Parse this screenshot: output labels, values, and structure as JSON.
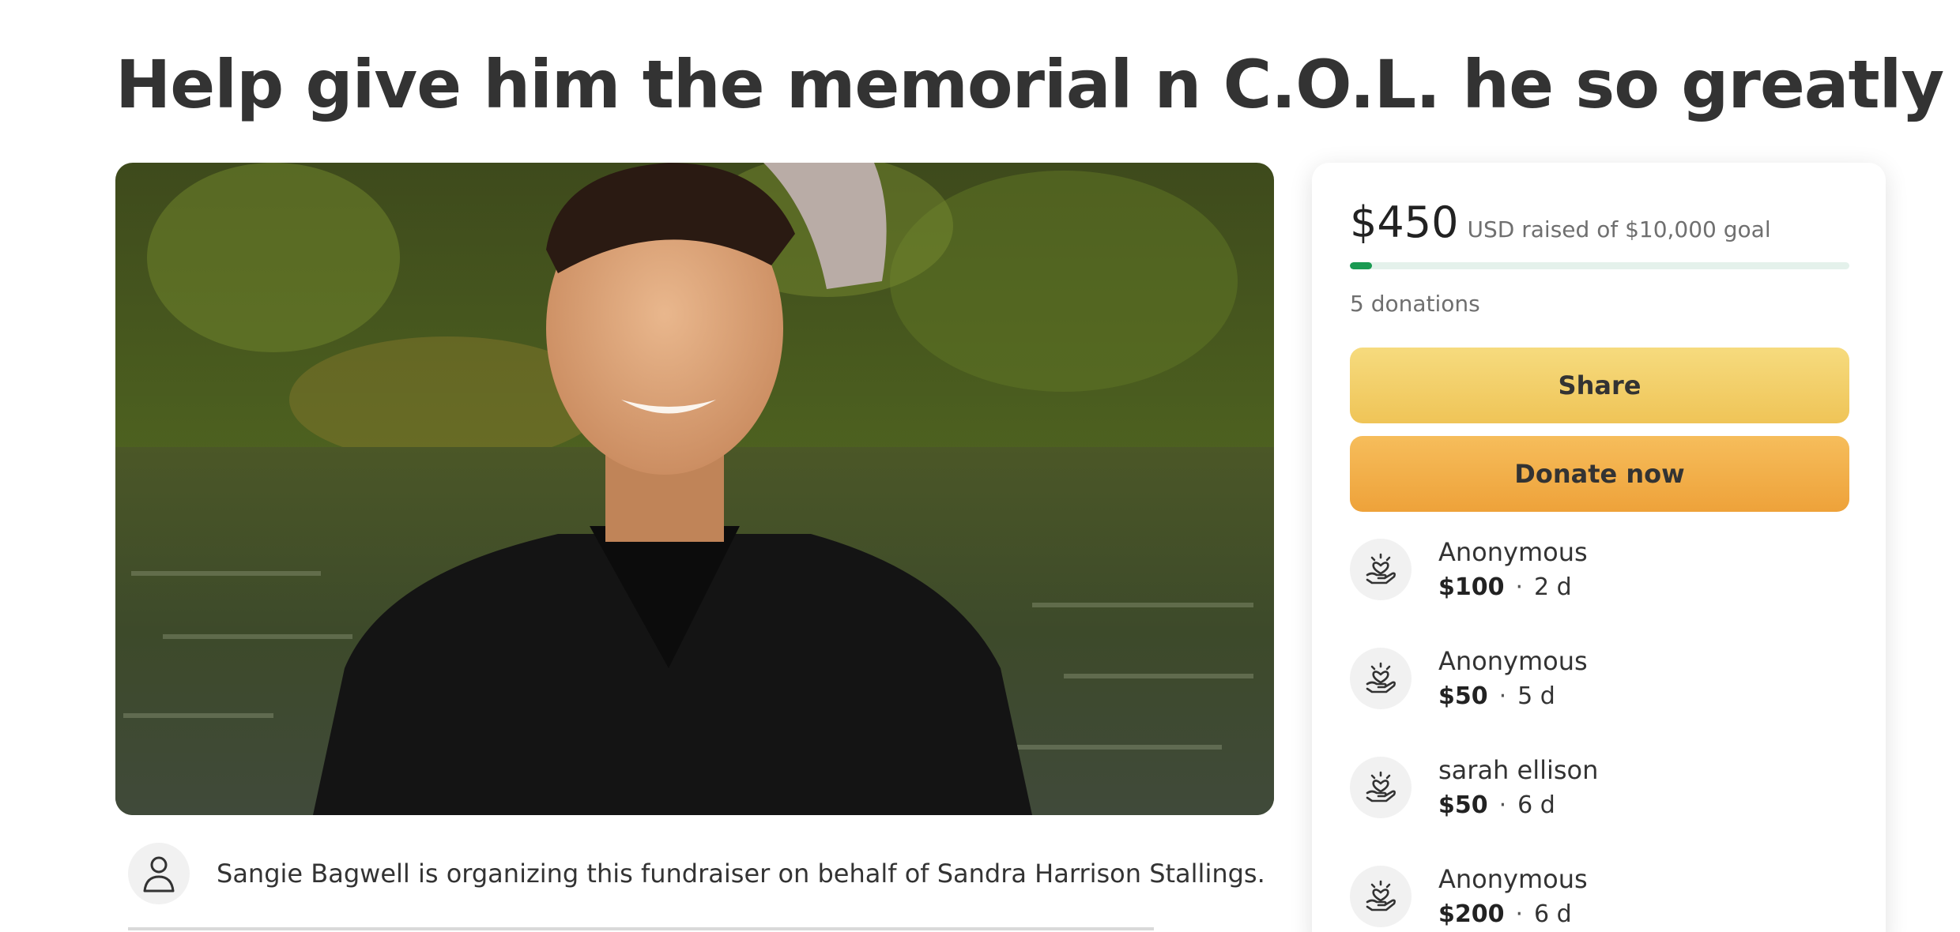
{
  "campaign": {
    "title": "Help give him the memorial n C.O.L. he so greatly deserves."
  },
  "organizer": {
    "text": "Sangie Bagwell is organizing this fundraiser on behalf of Sandra Harrison Stallings."
  },
  "progress": {
    "raised": "$450",
    "raised_desc": "USD raised of $10,000 goal",
    "fraction": 0.045,
    "donation_count": "5 donations",
    "fill_color": "#1a9a52"
  },
  "actions": {
    "share_label": "Share",
    "donate_label": "Donate now"
  },
  "donations": [
    {
      "name": "Anonymous",
      "amount": "$100",
      "time": "2 d"
    },
    {
      "name": "Anonymous",
      "amount": "$50",
      "time": "5 d"
    },
    {
      "name": "sarah ellison",
      "amount": "$50",
      "time": "6 d"
    },
    {
      "name": "Anonymous",
      "amount": "$200",
      "time": "6 d"
    }
  ],
  "icons": {
    "organizer": "person-icon",
    "donor": "heart-hand-icon"
  }
}
